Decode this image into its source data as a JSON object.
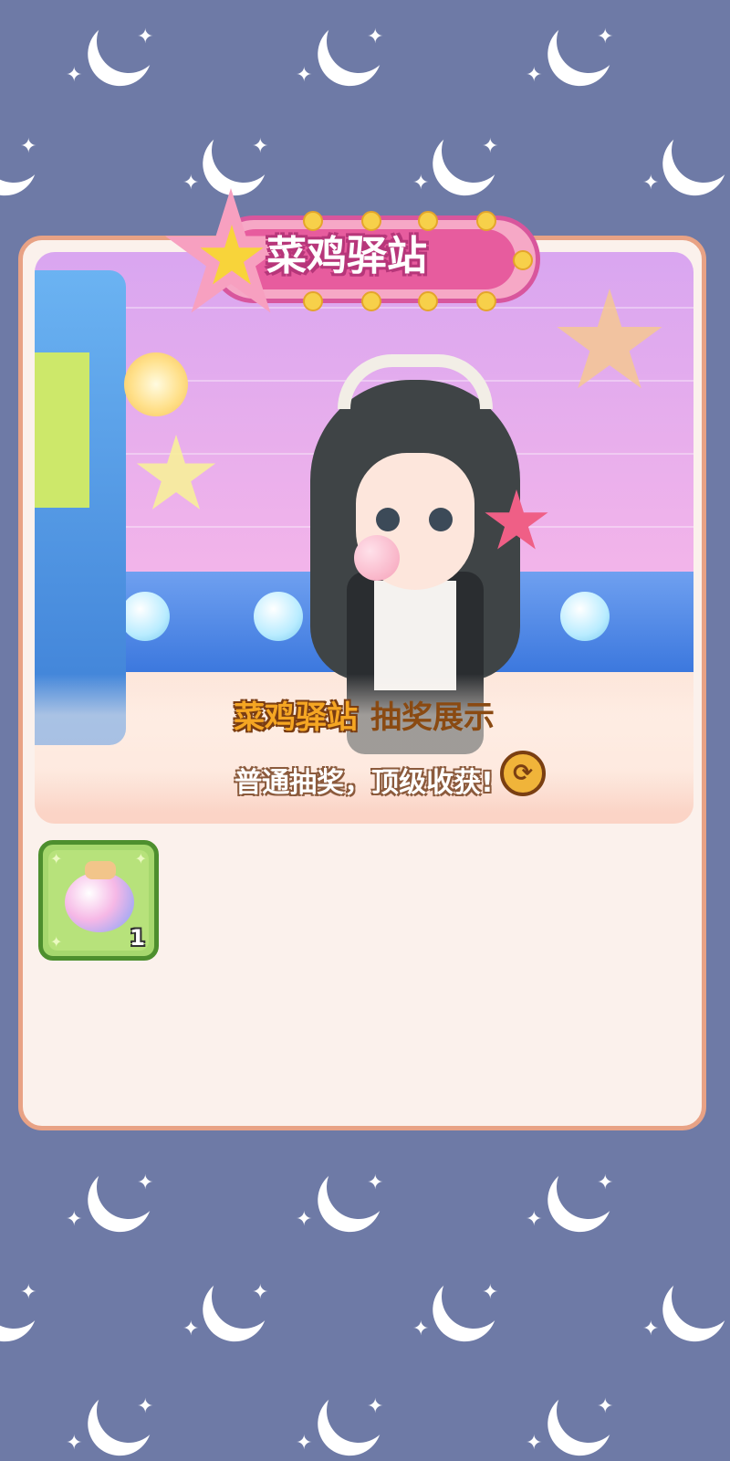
{
  "event": {
    "title": "菜鸡驿站",
    "caption_name": "菜鸡驿站",
    "caption_label": "抽奖展示",
    "caption_sub": "普通抽奖，顶级收获!",
    "refresh_icon": "refresh-icon",
    "refresh_glyph": "⟳"
  },
  "inventory": {
    "items": [
      {
        "icon": "potion-bottle-icon",
        "count": "1"
      }
    ]
  },
  "colors": {
    "background": "#6e7aa6",
    "panel_border": "#e8a285",
    "title_pink": "#e75c9e",
    "slot_green": "#a6d86e"
  }
}
